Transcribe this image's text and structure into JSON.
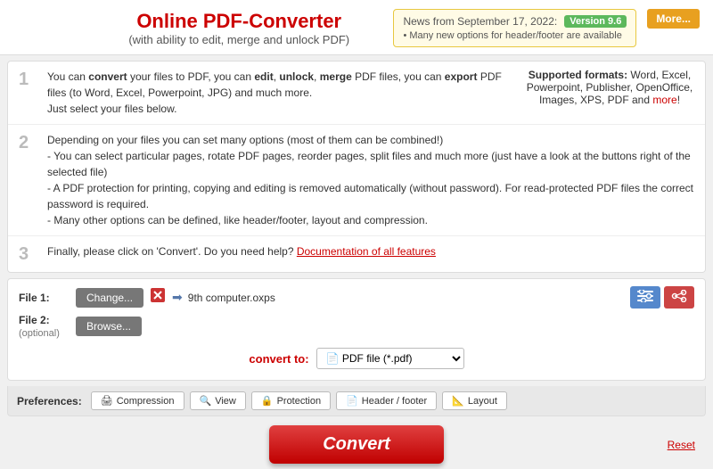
{
  "header": {
    "title": "Online PDF-Converter",
    "subtitle": "(with ability to edit, merge and unlock PDF)",
    "news_label": "News from September 17, 2022:",
    "version_badge": "Version 9.6",
    "news_item": "Many new options for header/footer are available",
    "more_button": "More..."
  },
  "steps": [
    {
      "number": "1",
      "text_html": "You can convert your files to PDF, you can edit, unlock, merge PDF files, you can export PDF files (to Word, Excel, Powerpoint, JPG) and much more.\nJust select your files below.",
      "aside_label": "Supported formats:",
      "aside_formats": "Word, Excel, Powerpoint, Publisher, OpenOffice, Images, XPS, PDF and more!"
    },
    {
      "number": "2",
      "lines": [
        "Depending on your files you can set many options (most of them can be combined!)",
        "- You can select particular pages, rotate PDF pages, reorder pages, split files and much more (just have a look at the buttons right of the selected file)",
        "- A PDF protection for printing, copying and editing is removed automatically (without password). For read-protected PDF files the correct password is required.",
        "- Many other options can be defined, like header/footer, layout and compression."
      ]
    },
    {
      "number": "3",
      "text": "Finally, please click on 'Convert'. Do you need help?",
      "doc_link": "Documentation of all features"
    }
  ],
  "files": {
    "file1_label": "File 1:",
    "file2_label": "File 2:",
    "optional_label": "(optional)",
    "change_btn": "Change...",
    "browse_btn": "Browse...",
    "file1_name": "9th computer.oxps",
    "delete_icon": "✕"
  },
  "convert_to": {
    "label": "convert to:",
    "format": "PDF file (*.pdf)",
    "pdf_icon": "📄"
  },
  "preferences": {
    "label": "Preferences:",
    "tabs": [
      {
        "icon": "🖨",
        "label": "Compression"
      },
      {
        "icon": "🔍",
        "label": "View"
      },
      {
        "icon": "🔒",
        "label": "Protection"
      },
      {
        "icon": "📄",
        "label": "Header / footer"
      },
      {
        "icon": "📐",
        "label": "Layout"
      }
    ]
  },
  "convert_button": "Convert",
  "reset_link": "Reset"
}
